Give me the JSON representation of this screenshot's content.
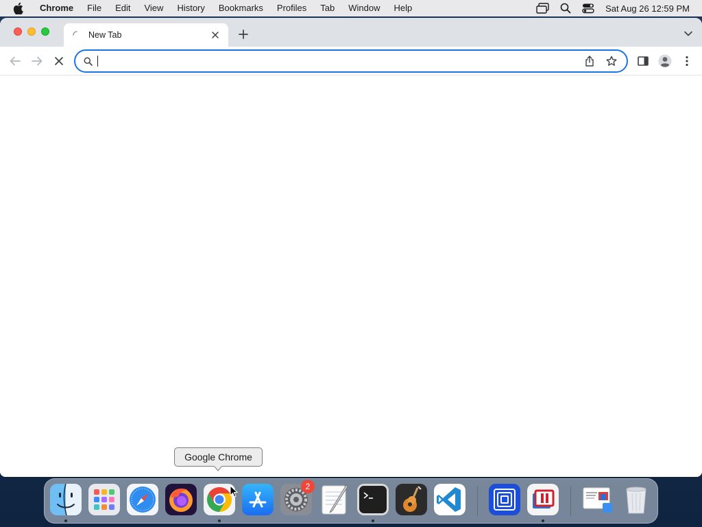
{
  "menubar": {
    "app_name": "Chrome",
    "items": [
      "File",
      "Edit",
      "View",
      "History",
      "Bookmarks",
      "Profiles",
      "Tab",
      "Window",
      "Help"
    ],
    "clock": "Sat Aug 26  12:59 PM"
  },
  "browser": {
    "tab_title": "New Tab",
    "omnibox_value": "",
    "omnibox_placeholder": ""
  },
  "tooltip": {
    "text": "Google Chrome"
  },
  "dock": {
    "items": [
      "Finder",
      "Launchpad",
      "Safari",
      "Firefox",
      "Google Chrome",
      "App Store",
      "System Settings",
      "TextEdit",
      "Terminal",
      "GarageBand",
      "Visual Studio Code",
      "Screens",
      "Parallels Desktop",
      "Parallels Desktop Folder",
      "Trash"
    ],
    "settings_badge": "2"
  },
  "colors": {
    "accent": "#1a73e8",
    "close": "#fe5f57",
    "minimize": "#febc2e",
    "maximize": "#28c840",
    "badge": "#f0473b"
  }
}
